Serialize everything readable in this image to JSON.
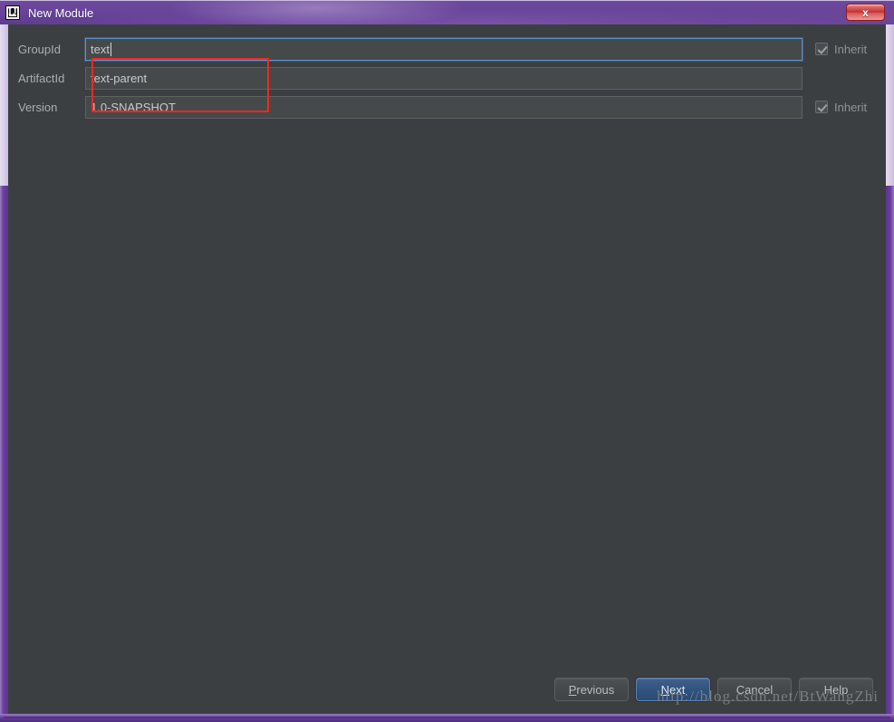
{
  "window": {
    "title": "New Module",
    "icon": "intellij-idea-icon",
    "close_label": "x",
    "accent_color": "#6a4799",
    "body_color": "#3c3f41"
  },
  "form": {
    "rows": [
      {
        "label": "GroupId",
        "value": "text",
        "placeholder": "",
        "focused": true,
        "has_inherit": true,
        "inherit_label": "Inherit",
        "inherit_checked": true
      },
      {
        "label": "ArtifactId",
        "value": "text-parent",
        "placeholder": "",
        "focused": false,
        "has_inherit": false,
        "inherit_label": "",
        "inherit_checked": false
      },
      {
        "label": "Version",
        "value": "1.0-SNAPSHOT",
        "placeholder": "",
        "focused": false,
        "has_inherit": true,
        "inherit_label": "Inherit",
        "inherit_checked": true
      }
    ]
  },
  "annotation": {
    "color": "#f2281e",
    "note": "highlight-box"
  },
  "buttons": [
    {
      "label": "Previous",
      "mnemonic": "P",
      "default": false
    },
    {
      "label": "Next",
      "mnemonic": "N",
      "default": true
    },
    {
      "label": "Cancel",
      "mnemonic": "",
      "default": false
    },
    {
      "label": "Help",
      "mnemonic": "",
      "default": false
    }
  ],
  "watermark": {
    "text": "http://blog.csdn.net/BtWangZhi"
  }
}
